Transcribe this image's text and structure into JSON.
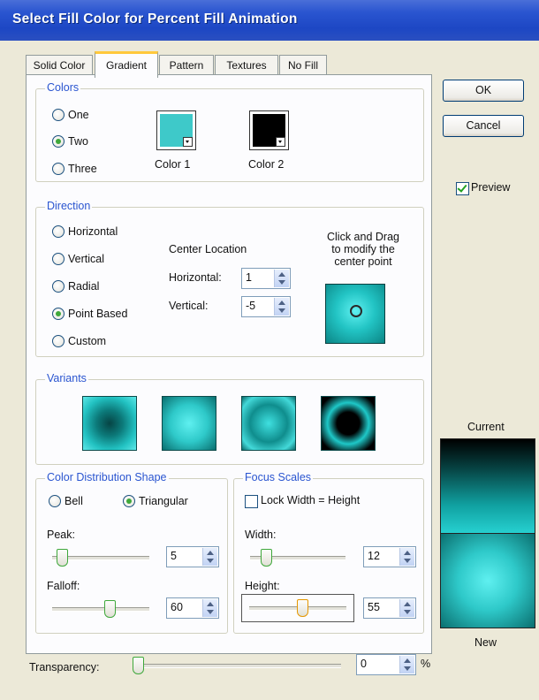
{
  "window": {
    "title": "Select Fill Color for Percent Fill Animation"
  },
  "tabs": [
    "Solid Color",
    "Gradient",
    "Pattern",
    "Textures",
    "No Fill"
  ],
  "active_tab": "Gradient",
  "colors": {
    "group_title": "Colors",
    "options": [
      "One",
      "Two",
      "Three"
    ],
    "selected": "Two",
    "color1_label": "Color 1",
    "color2_label": "Color 2",
    "color1_value": "#3ec9c9",
    "color2_value": "#000000"
  },
  "direction": {
    "group_title": "Direction",
    "options": [
      "Horizontal",
      "Vertical",
      "Radial",
      "Point Based",
      "Custom"
    ],
    "selected": "Point Based",
    "center_location_label": "Center Location",
    "horizontal_label": "Horizontal:",
    "horizontal_value": "1",
    "vertical_label": "Vertical:",
    "vertical_value": "-5",
    "hint_line1": "Click and Drag",
    "hint_line2": "to modify the",
    "hint_line3": "center point"
  },
  "variants": {
    "group_title": "Variants"
  },
  "distribution": {
    "group_title": "Color Distribution Shape",
    "options": [
      "Bell",
      "Triangular"
    ],
    "selected": "Triangular",
    "peak_label": "Peak:",
    "peak_value": "5",
    "peak_fraction": 0.05,
    "falloff_label": "Falloff:",
    "falloff_value": "60",
    "falloff_fraction": 0.6
  },
  "focus": {
    "group_title": "Focus Scales",
    "lock_label": "Lock Width = Height",
    "lock_checked": false,
    "width_label": "Width:",
    "width_value": "12",
    "width_fraction": 0.12,
    "height_label": "Height:",
    "height_value": "55",
    "height_fraction": 0.55
  },
  "transparency": {
    "label": "Transparency:",
    "value": "0",
    "unit": "%",
    "fraction": 0.0
  },
  "buttons": {
    "ok": "OK",
    "cancel": "Cancel"
  },
  "preview": {
    "label": "Preview",
    "checked": true
  },
  "current_label": "Current",
  "new_label": "New",
  "colors_theme": {
    "accent": "#2a55d0",
    "teal": "#21c2c2",
    "title_bar": "#1d47c4"
  }
}
